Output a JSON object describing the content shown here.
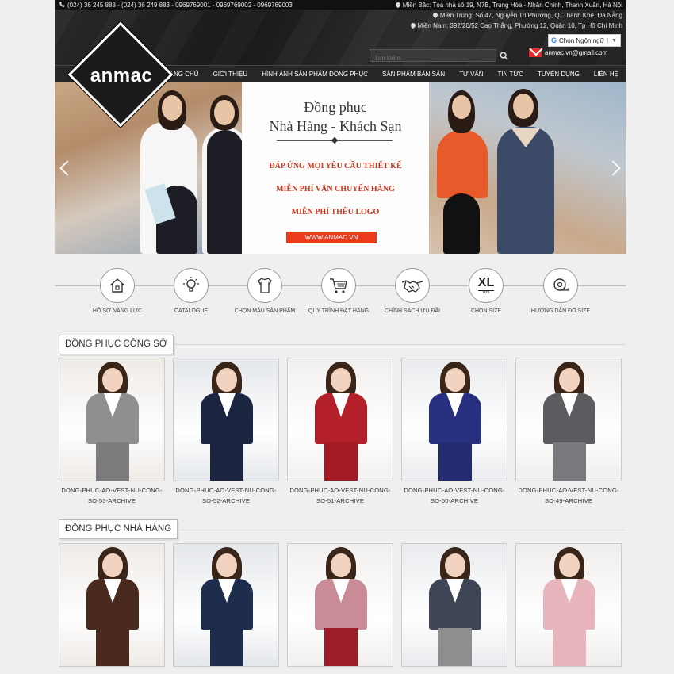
{
  "topbar": {
    "phone": "(024) 36 245 888 - (024) 36 249 888 - 0969769001 - 0969769002 - 0969769003",
    "addresses": [
      "Miền Bắc: Tòa nhà số 19, N7B, Trung Hòa - Nhân Chính, Thanh Xuân, Hà Nội",
      "Miền Trung: Số 47, Nguyễn Tri Phương, Q. Thanh Khê, Đà Nẵng",
      "Miền Nam: 392/20/52 Cao Thắng, Phường 12, Quận 10, Tp Hồ Chí Minh"
    ],
    "language_label": "Chọn Ngôn ngữ",
    "search_placeholder": "Tìm kiếm",
    "email": "anmac.vn@gmail.com"
  },
  "logo": {
    "text": "anmac"
  },
  "nav": {
    "items": [
      "TRANG CHỦ",
      "GIỚI THIỆU",
      "HÌNH ẢNH SẢN PHẨM ĐỒNG PHỤC",
      "SẢN PHẨM BÁN SẴN",
      "TƯ VẤN",
      "TIN TỨC",
      "TUYỂN DỤNG",
      "LIÊN HỆ"
    ]
  },
  "banner": {
    "title_line1": "Đồng phục",
    "title_line2": "Nhà Hàng - Khách Sạn",
    "lines": [
      "ĐÁP ỨNG MỌI YÊU CẦU THIẾT KẾ",
      "MIỄN PHÍ VẬN CHUYỂN HÀNG",
      "MIỄN PHÍ THÊU LOGO"
    ],
    "button": "WWW.ANMAC.VN"
  },
  "features": [
    {
      "label": "HỒ SƠ NĂNG LỰC",
      "icon": "house-icon"
    },
    {
      "label": "CATALOGUE",
      "icon": "lightbulb-icon"
    },
    {
      "label": "CHỌN MẪU SẢN PHẨM",
      "icon": "shirt-icon"
    },
    {
      "label": "QUY TRÌNH ĐẶT HÀNG",
      "icon": "cart-icon"
    },
    {
      "label": "CHÍNH SÁCH ƯU ĐÃI",
      "icon": "handshake-icon"
    },
    {
      "label": "CHỌN SIZE",
      "icon": "size-xl-icon",
      "badge": "XL",
      "badge_sub": "size"
    },
    {
      "label": "HƯỚNG DẪN ĐO SIZE",
      "icon": "tape-measure-icon"
    }
  ],
  "sections": [
    {
      "title": "ĐỒNG PHỤC CÔNG SỞ",
      "products": [
        {
          "caption_line1": "DONG-PHUC-AO-VEST-NU-CONG-",
          "caption_line2": "SO-53-ARCHIVE",
          "color": "#8f8f92",
          "skirt": "#7c7c7e"
        },
        {
          "caption_line1": "DONG-PHUC-AO-VEST-NU-CONG-",
          "caption_line2": "SO-52-ARCHIVE",
          "color": "#1c2540",
          "skirt": "#1c2540"
        },
        {
          "caption_line1": "DONG-PHUC-AO-VEST-NU-CONG-",
          "caption_line2": "SO-51-ARCHIVE",
          "color": "#b3202a",
          "skirt": "#a31b24"
        },
        {
          "caption_line1": "DONG-PHUC-AO-VEST-NU-CONG-",
          "caption_line2": "SO-50-ARCHIVE",
          "color": "#27307e",
          "skirt": "#242c70"
        },
        {
          "caption_line1": "DONG-PHUC-AO-VEST-NU-CONG-",
          "caption_line2": "SO-49-ARCHIVE",
          "color": "#5b5b60",
          "skirt": "#7a7a7e"
        }
      ]
    },
    {
      "title": "ĐỒNG PHỤC NHÀ HÀNG",
      "products": [
        {
          "color": "#4a2a1e",
          "skirt": "#4a2a1e"
        },
        {
          "color": "#1f2d4d",
          "skirt": "#1f2d4d"
        },
        {
          "color": "#c98c96",
          "skirt": "#9c1e2a"
        },
        {
          "color": "#3e4655",
          "skirt": "#8e8e8e"
        },
        {
          "color": "#e7b5bb",
          "skirt": "#e7b5bb"
        }
      ]
    }
  ]
}
